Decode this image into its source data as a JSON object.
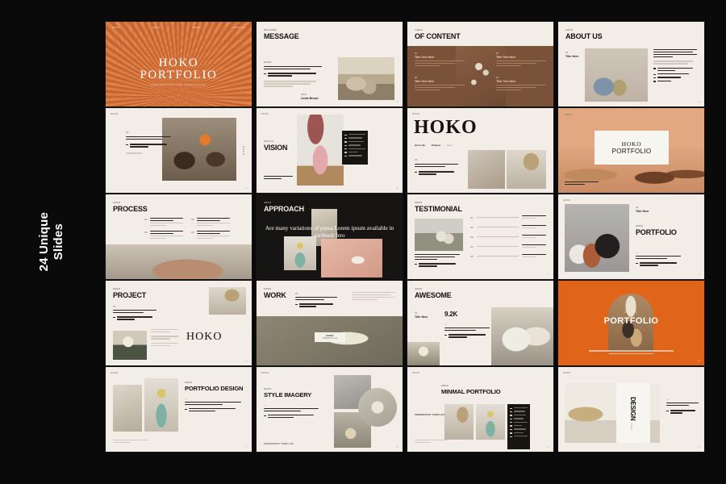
{
  "canvas": {
    "background": "#0a0a0a",
    "side_label_line1": "24 Unique",
    "side_label_line2": "Slides"
  },
  "brand": "HOKO",
  "palette": {
    "orange": "#d9783f",
    "bright_orange": "#e0651a",
    "peach": "#e2a882",
    "brown": "#7a5139",
    "cream": "#f2eee7",
    "dark": "#171513"
  },
  "slides": [
    {
      "n": "01",
      "eyebrow": "",
      "title": "HOKO",
      "title2": "PORTFOLIO",
      "subtitle": "PRESENTATION TEMPLATE",
      "nav": [
        "HOKO",
        "INDEX",
        "WORK",
        "CONTACT"
      ],
      "page": "01"
    },
    {
      "n": "02",
      "eyebrow": "WELCOME",
      "title": "MESSAGE",
      "body_label": "HOKO",
      "signature_label": "CEO",
      "signature": "Linda Brown",
      "page": "02"
    },
    {
      "n": "03",
      "eyebrow": "TABLE",
      "title": "OF CONTENT",
      "items": [
        {
          "num": "01",
          "label": "Title Text Here"
        },
        {
          "num": "02",
          "label": "Title Text Here"
        },
        {
          "num": "03",
          "label": "Title Text Here"
        },
        {
          "num": "04",
          "label": "Title Text Here"
        }
      ],
      "page": "03"
    },
    {
      "n": "04",
      "eyebrow": "HOKO",
      "title": "ABOUT US",
      "sub_num": "01",
      "sub_label": "Title Here",
      "page": "04"
    },
    {
      "n": "05",
      "eyebrow": "HOKO",
      "title": "",
      "side_text": "HOKO",
      "page": "05"
    },
    {
      "n": "06",
      "eyebrow": "HOKO'S",
      "title": "VISION",
      "page": "06"
    },
    {
      "n": "07",
      "eyebrow": "HOKO",
      "title": "HOKO",
      "meta1": "Get to the",
      "meta2": "Purpose",
      "meta3": "Hoko",
      "page": "07"
    },
    {
      "n": "08",
      "eyebrow": "HOKO",
      "title": "HOKO",
      "title2": "PORTFOLIO",
      "page": "08"
    },
    {
      "n": "09",
      "eyebrow": "HOKO",
      "title": "PROCESS",
      "steps": [
        {
          "num": "01"
        },
        {
          "num": "02"
        },
        {
          "num": "03"
        },
        {
          "num": "04"
        }
      ],
      "page": "09"
    },
    {
      "n": "10",
      "eyebrow": "HOKO",
      "title": "APPROACH",
      "quote": "Are many variations of passa Lorem ipsum available in sorthsuit fero",
      "page": "10"
    },
    {
      "n": "11",
      "eyebrow": "HOKO",
      "title": "TESTIMONIAL",
      "rows": [
        "01",
        "02",
        "03",
        "04",
        "05"
      ],
      "page": "11"
    },
    {
      "n": "12",
      "eyebrow": "HOKO",
      "title": "PORTFOLIO",
      "sub_num": "01",
      "sub_label": "Title Here",
      "page": "12"
    },
    {
      "n": "13",
      "eyebrow": "HOKO",
      "title": "PROJECT",
      "display": "HOKO",
      "page": "13"
    },
    {
      "n": "14",
      "eyebrow": "HOKO",
      "title": "WORK",
      "badge1": "HOKO",
      "badge2": "PORTFOLIO",
      "page": "14"
    },
    {
      "n": "15",
      "eyebrow": "HOKO",
      "title": "AWESOME",
      "stat": "9.2K",
      "sub_num": "01",
      "sub_label": "Title Here",
      "page": "15"
    },
    {
      "n": "16",
      "eyebrow": "HOKO'S",
      "title": "PORTFOLIO",
      "page": "16"
    },
    {
      "n": "17",
      "eyebrow": "HOKO",
      "title": "PORTFOLIO DESIGN",
      "footer": "Are many variations available",
      "page": "17"
    },
    {
      "n": "18",
      "eyebrow": "HOKO",
      "title": "STYLE IMAGERY",
      "footer": "POWERPOINT TEMPLATE",
      "page": "18"
    },
    {
      "n": "19",
      "eyebrow": "HOKO",
      "title": "MINMAL PORTFOLIO",
      "footer": "POWERPOINT TEMPLATE",
      "page": "19"
    },
    {
      "n": "20",
      "eyebrow": "HOKO",
      "title": "DESIGN",
      "side_label": "HOKO",
      "page": "20"
    }
  ]
}
